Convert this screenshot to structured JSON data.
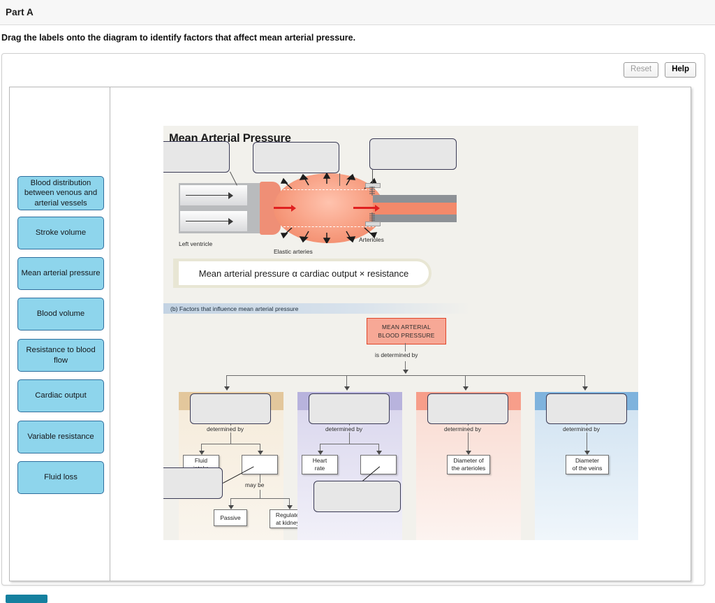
{
  "header": {
    "part_title": "Part A"
  },
  "prompt": "Drag the labels onto the diagram to identify factors that affect mean arterial pressure.",
  "toolbar": {
    "reset_label": "Reset",
    "help_label": "Help"
  },
  "label_bank": [
    "Blood distribution between venous and arterial vessels",
    "Stroke volume",
    "Mean arterial pressure",
    "Blood volume",
    "Resistance to blood flow",
    "Cardiac output",
    "Variable resistance",
    "Fluid loss"
  ],
  "figure": {
    "title": "Mean Arterial Pressure",
    "illustration_labels": {
      "left_ventricle": "Left ventricle",
      "elastic_arteries": "Elastic arteries",
      "arterioles": "Arterioles"
    },
    "formula": "Mean arterial pressure α cardiac output × resistance",
    "band_caption": "(b) Factors that influence mean arterial pressure",
    "root_box_line1": "MEAN ARTERIAL",
    "root_box_line2": "BLOOD PRESSURE",
    "root_connector": "is determined by",
    "columns": [
      {
        "connector": "determined by",
        "children": [
          "Fluid\nintake",
          ""
        ],
        "may_be": "may be",
        "grandchildren": [
          "Passive",
          "Regulated\nat kidneys"
        ]
      },
      {
        "connector": "determined by",
        "children": [
          "Heart\nrate",
          ""
        ]
      },
      {
        "connector": "determined by",
        "children": [
          "Diameter of\nthe arterioles"
        ]
      },
      {
        "connector": "determined by",
        "children": [
          "Diameter\nof the veins"
        ]
      }
    ]
  },
  "colors": {
    "chip": "#8ed5ec",
    "chip_border": "#2f6f9e",
    "root_box": "#f7a896",
    "root_border": "#e0452a",
    "col1": "#e3c79c",
    "col2": "#b8b3dd",
    "col3": "#f79e8a",
    "col4": "#7fb3dd",
    "teal_button": "#15809f"
  }
}
